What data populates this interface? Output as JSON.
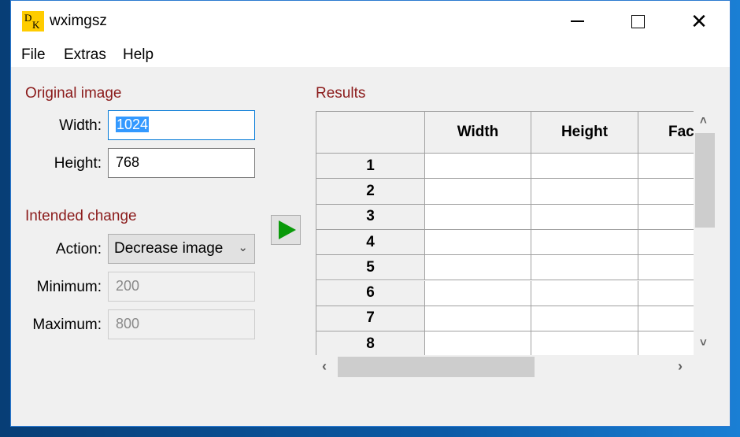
{
  "window": {
    "title": "wxImgSz",
    "title_display": "wximgsz",
    "icon_letters": [
      "D",
      "K"
    ],
    "controls": {
      "minimize": "—",
      "maximize": "☐",
      "close": "✕"
    }
  },
  "menubar": {
    "items": [
      "File",
      "Extras",
      "Help"
    ]
  },
  "original_image": {
    "section_label": "Original image",
    "width_label": "Width:",
    "width_value": "1024",
    "height_label": "Height:",
    "height_value": "768"
  },
  "intended_change": {
    "section_label": "Intended change",
    "action_label": "Action:",
    "action_value": "Decrease image",
    "minimum_label": "Minimum:",
    "minimum_value": "200",
    "maximum_label": "Maximum:",
    "maximum_value": "800"
  },
  "run_button": {
    "icon": "play-icon",
    "color": "#0a9a0a"
  },
  "results": {
    "section_label": "Results",
    "columns": [
      "Width",
      "Height",
      "Fac"
    ],
    "rows": [
      "1",
      "2",
      "3",
      "4",
      "5",
      "6",
      "7",
      "8"
    ],
    "cells": [
      [
        "",
        "",
        ""
      ],
      [
        "",
        "",
        ""
      ],
      [
        "",
        "",
        ""
      ],
      [
        "",
        "",
        ""
      ],
      [
        "",
        "",
        ""
      ],
      [
        "",
        "",
        ""
      ],
      [
        "",
        "",
        ""
      ],
      [
        "",
        "",
        ""
      ]
    ]
  },
  "scroll": {
    "up": "˄",
    "down": "˅",
    "left": "‹",
    "right": "›"
  },
  "colors": {
    "section_label": "#8b1b1b",
    "selection": "#3399ff",
    "focus_border": "#0078d7"
  }
}
